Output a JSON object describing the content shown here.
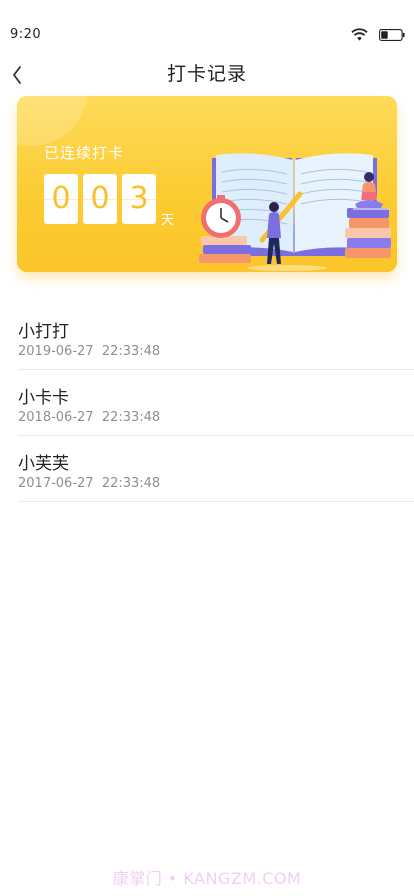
{
  "status_bar": {
    "time": "9:20",
    "wifi_icon": "wifi-icon",
    "battery_icon": "battery-icon"
  },
  "nav": {
    "back_icon": "chevron-left-icon",
    "title": "打卡记录"
  },
  "hero": {
    "label": "已连续打卡",
    "digits": [
      "0",
      "0",
      "3"
    ],
    "unit": "天",
    "illustration": "open-book-reading-illustration"
  },
  "records": [
    {
      "name": "小打打",
      "time": "2019-06-27  22:33:48"
    },
    {
      "name": "小卡卡",
      "time": "2018-06-27  22:33:48"
    },
    {
      "name": "小芙芙",
      "time": "2017-06-27  22:33:48"
    }
  ],
  "watermark": "康掌门 • KANGZM.COM",
  "colors": {
    "accent": "#fccc33",
    "digit": "#fbbf2a",
    "divider": "#e8e8e8",
    "subtext": "#8f8f8f"
  }
}
